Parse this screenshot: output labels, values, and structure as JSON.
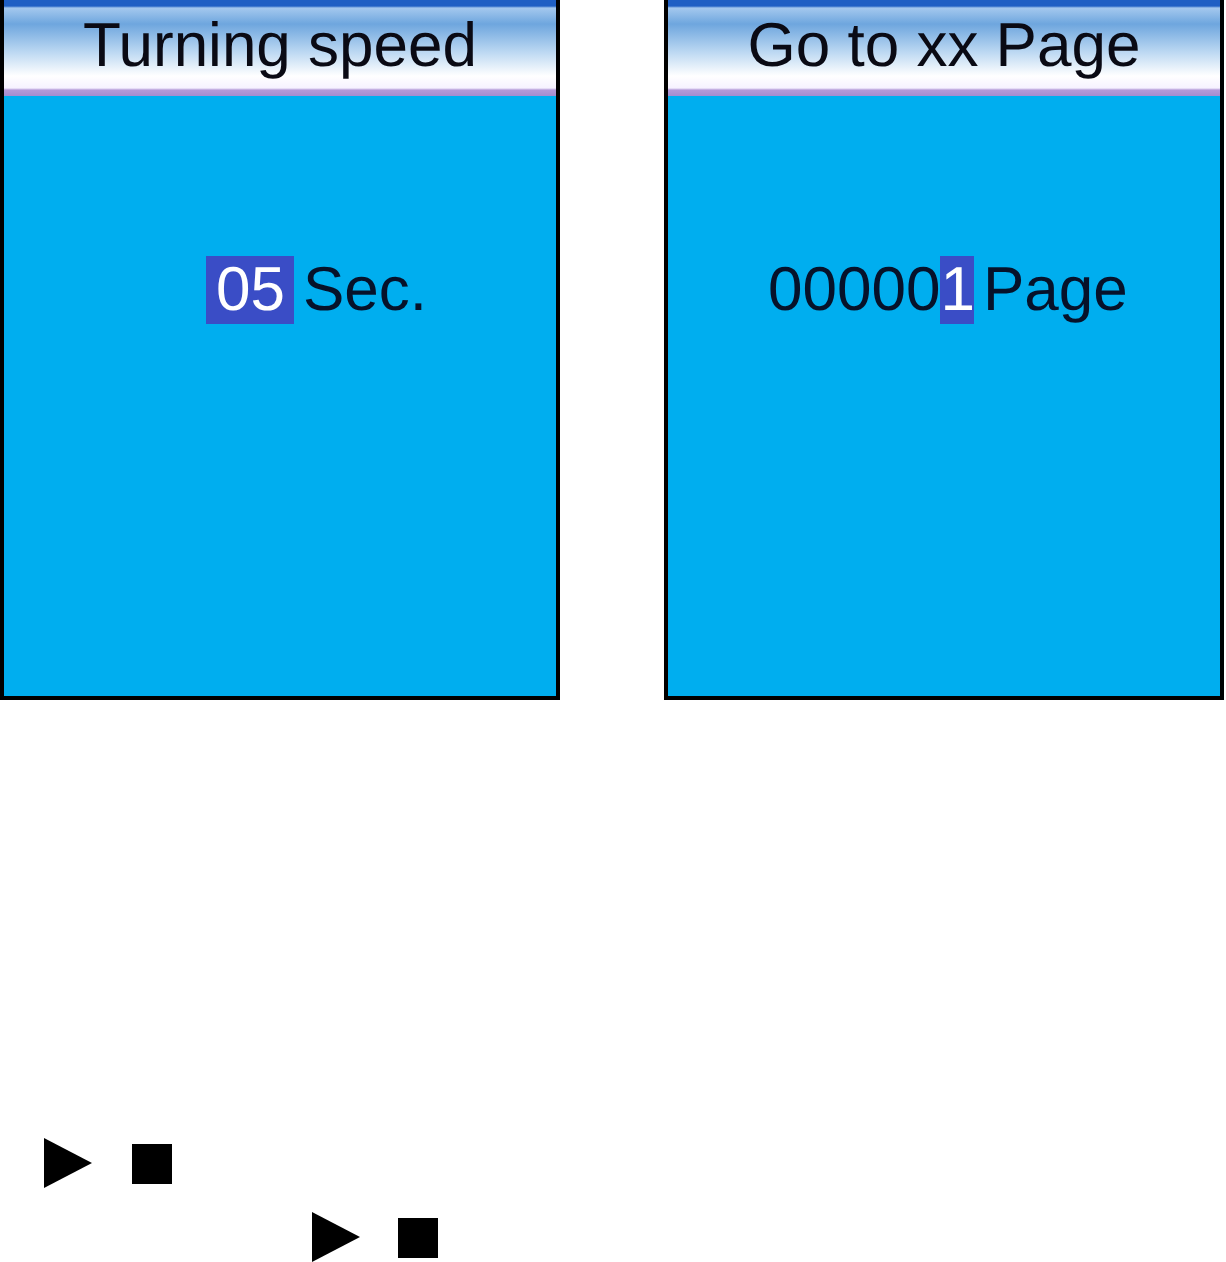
{
  "screens": [
    {
      "title": "Turning speed",
      "value": [
        {
          "text": "05",
          "selected": true
        }
      ],
      "unit": "Sec."
    },
    {
      "title": "Go to xx Page",
      "value": [
        {
          "text": "00000",
          "selected": false
        },
        {
          "text": "1",
          "selected": true
        }
      ],
      "unit": "Page"
    }
  ]
}
